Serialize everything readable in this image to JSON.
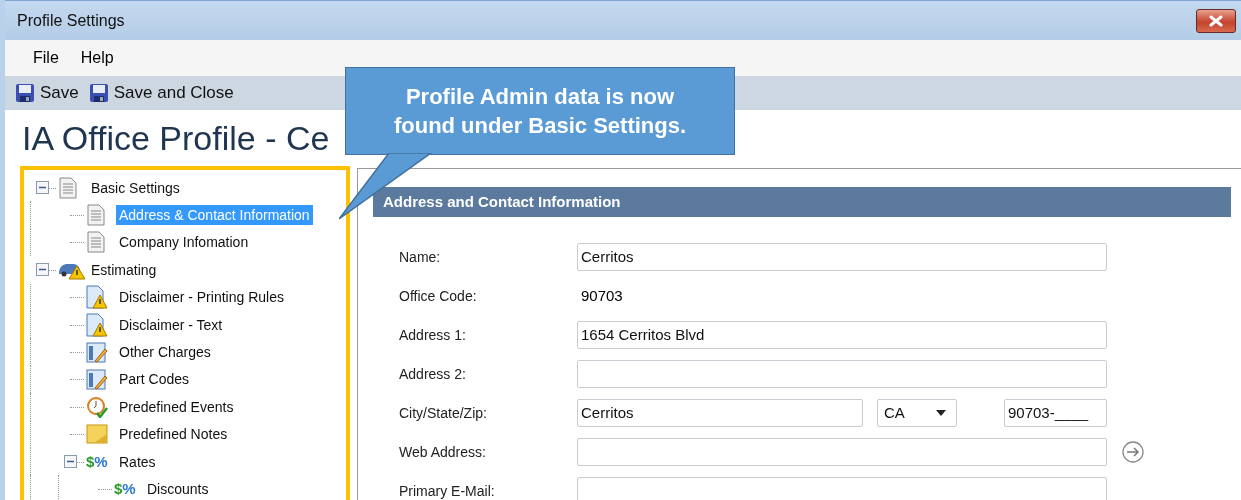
{
  "window": {
    "title": "Profile Settings"
  },
  "menu": [
    "File",
    "Help"
  ],
  "toolbar": [
    "Save",
    "Save and Close"
  ],
  "heading": "IA Office Profile - Ce",
  "callout": "Profile Admin data is now found under Basic Settings.",
  "tree": [
    {
      "label": "Basic Settings",
      "kind": "document",
      "selected": false,
      "expanded": true,
      "children": [
        {
          "label": "Address & Contact Information",
          "kind": "document",
          "selected": true
        },
        {
          "label": "Company Infomation",
          "kind": "document",
          "selected": false
        }
      ]
    },
    {
      "label": "Estimating",
      "kind": "car-warning",
      "selected": false,
      "expanded": true,
      "children": [
        {
          "label": "Disclaimer - Printing Rules",
          "kind": "document-warning",
          "selected": false
        },
        {
          "label": "Disclaimer - Text",
          "kind": "document-warning",
          "selected": false
        },
        {
          "label": "Other Charges",
          "kind": "form-pencil",
          "selected": false
        },
        {
          "label": "Part Codes",
          "kind": "form-pencil",
          "selected": false
        },
        {
          "label": "Predefined Events",
          "kind": "clock-check",
          "selected": false
        },
        {
          "label": "Predefined Notes",
          "kind": "note",
          "selected": false
        },
        {
          "label": "Rates",
          "kind": "rates",
          "glyph": "$%",
          "selected": false,
          "expanded": true,
          "children": [
            {
              "label": "Discounts",
              "kind": "rates",
              "glyph": "$%",
              "selected": false
            }
          ]
        }
      ]
    }
  ],
  "form": {
    "title": "Address and Contact Information",
    "rows": [
      {
        "label": "Name:",
        "kind": "input",
        "value": "Cerritos"
      },
      {
        "label": "Office Code:",
        "kind": "static",
        "value": "90703"
      },
      {
        "label": "Address 1:",
        "kind": "input",
        "value": "1654 Cerritos Blvd"
      },
      {
        "label": "Address 2:",
        "kind": "input"
      },
      {
        "label": "City/State/Zip:",
        "kind": "city",
        "city": "Cerritos",
        "state": "CA",
        "zip": "90703-____"
      },
      {
        "label": "Web Address:",
        "kind": "input",
        "go_button": true
      },
      {
        "label": "Primary E-Mail:",
        "kind": "input"
      }
    ]
  }
}
